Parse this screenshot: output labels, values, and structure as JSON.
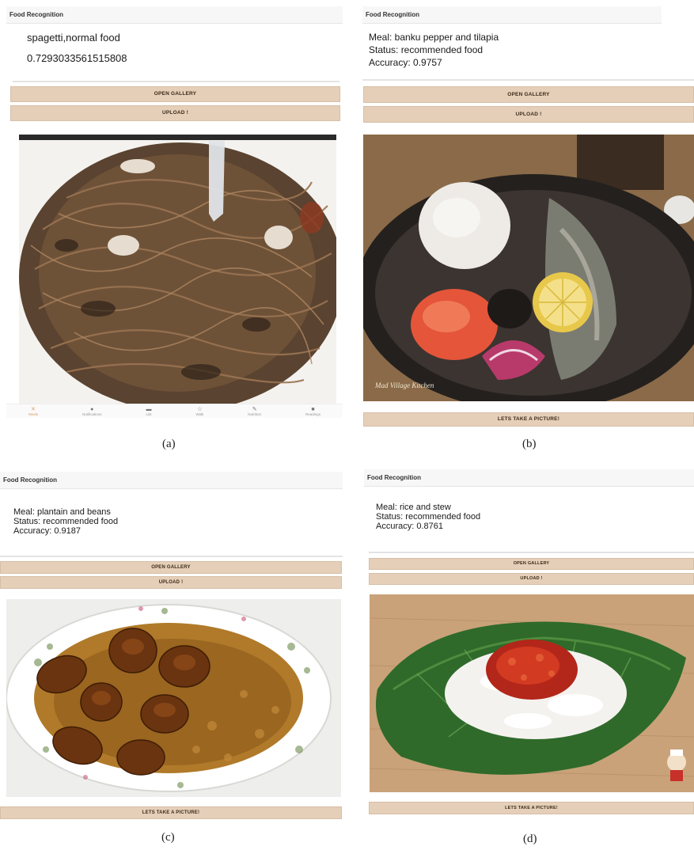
{
  "panels": {
    "a": {
      "title": "Food Recognition",
      "result_line1": "spagetti,normal food",
      "result_line2": "0.7293033561515808",
      "open_gallery": "OPEN GALLERY",
      "upload": "UPLOAD !",
      "caption": "(a)",
      "nav": [
        {
          "label": "Meals",
          "icon": "fork-knife-icon",
          "glyph": "✕"
        },
        {
          "label": "Notifications",
          "icon": "bell-icon",
          "glyph": "●"
        },
        {
          "label": "List",
          "icon": "list-icon",
          "glyph": "▬"
        },
        {
          "label": "Walk",
          "icon": "walk-icon",
          "glyph": "☆"
        },
        {
          "label": "Nutrition",
          "icon": "carrot-icon",
          "glyph": "✎"
        },
        {
          "label": "Readings",
          "icon": "camera-icon",
          "glyph": "■"
        }
      ]
    },
    "b": {
      "title": "Food Recognition",
      "meal": "Meal: banku pepper and tilapia",
      "status": "Status: recommended food",
      "accuracy": "Accuracy: 0.9757",
      "open_gallery": "OPEN GALLERY",
      "upload": "UPLOAD !",
      "take_picture": "LETS TAKE A PICTURE!",
      "photo_watermark": "Mad Village Kitchen",
      "caption": "(b)"
    },
    "c": {
      "title": "Food Recognition",
      "meal": "Meal: plantain and beans",
      "status": "Status: recommended food",
      "accuracy": "Accuracy: 0.9187",
      "open_gallery": "OPEN GALLERY",
      "upload": "UPLOAD !",
      "take_picture": "LETS TAKE A PICTURE!",
      "caption": "(c)"
    },
    "d": {
      "title": "Food Recognition",
      "meal": "Meal: rice and stew",
      "status": "Status: recommended food",
      "accuracy": "Accuracy: 0.8761",
      "open_gallery": "OPEN GALLERY",
      "upload": "UPLOAD !",
      "take_picture": "LETS TAKE A PICTURE!",
      "caption": "(d)"
    }
  },
  "colors": {
    "button_bg": "#e5cfb8",
    "titlebar_bg": "#f7f7f7",
    "nav_active": "#d8a066"
  }
}
